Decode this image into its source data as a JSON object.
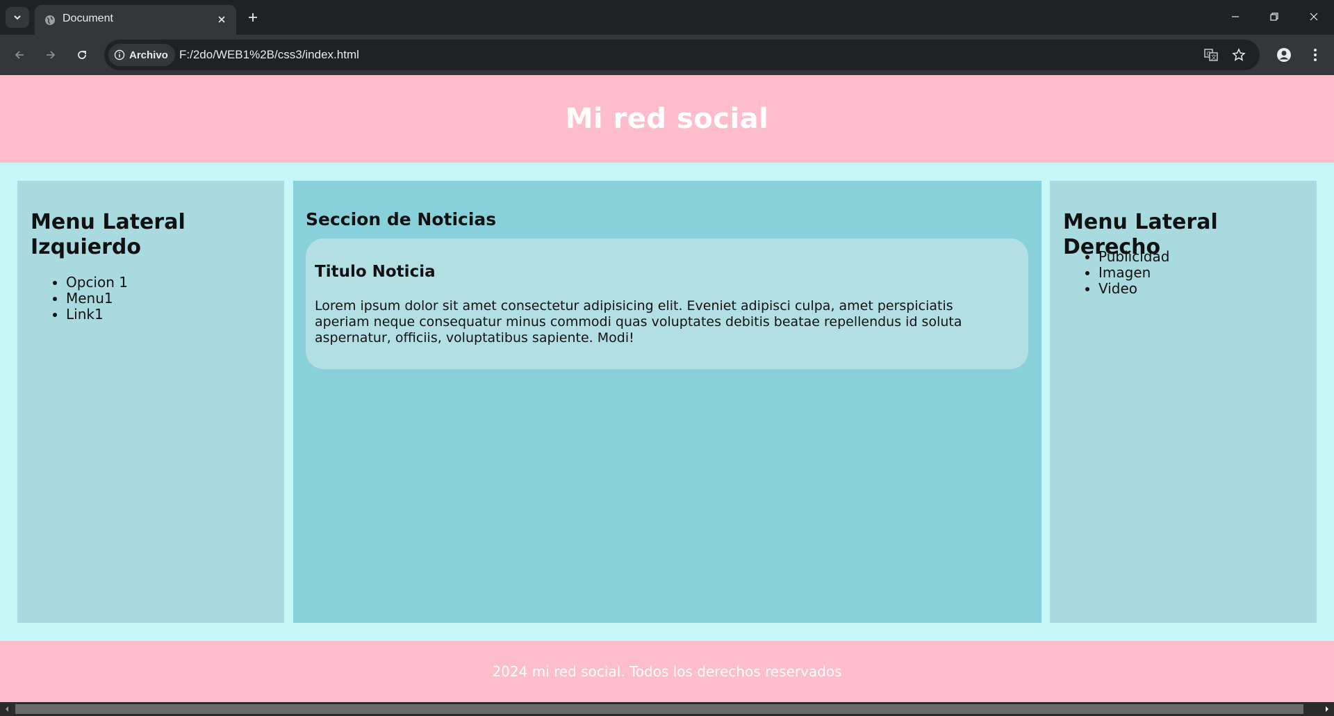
{
  "browser": {
    "tab_title": "Document",
    "security_chip": "Archivo",
    "url": "F:/2do/WEB1%2B/css3/index.html"
  },
  "page": {
    "header_title": "Mi red social",
    "left_sidebar": {
      "title": "Menu Lateral Izquierdo",
      "items": [
        "Opcion 1",
        "Menu1",
        "Link1"
      ]
    },
    "main": {
      "section_title": "Seccion de Noticias",
      "article": {
        "title": "Titulo Noticia",
        "body": "Lorem ipsum dolor sit amet consectetur adipisicing elit. Eveniet adipisci culpa, amet perspiciatis aperiam neque consequatur minus commodi quas voluptates debitis beatae repellendus id soluta aspernatur, officiis, voluptatibus sapiente. Modi!"
      }
    },
    "right_sidebar": {
      "title": "Menu Lateral Derecho",
      "items": [
        "Publicidad",
        "Imagen",
        "Video"
      ]
    },
    "footer_text": "2024 mi red social. Todos los derechos reservados"
  },
  "colors": {
    "header_footer_bg": "#fdbdca",
    "page_bg": "#c6f7f6",
    "sidebar_bg": "#a8dadf",
    "main_bg": "#89d1da",
    "card_bg": "#b1dfe4",
    "chrome_dark": "#202124",
    "chrome_toolbar": "#35363a"
  }
}
